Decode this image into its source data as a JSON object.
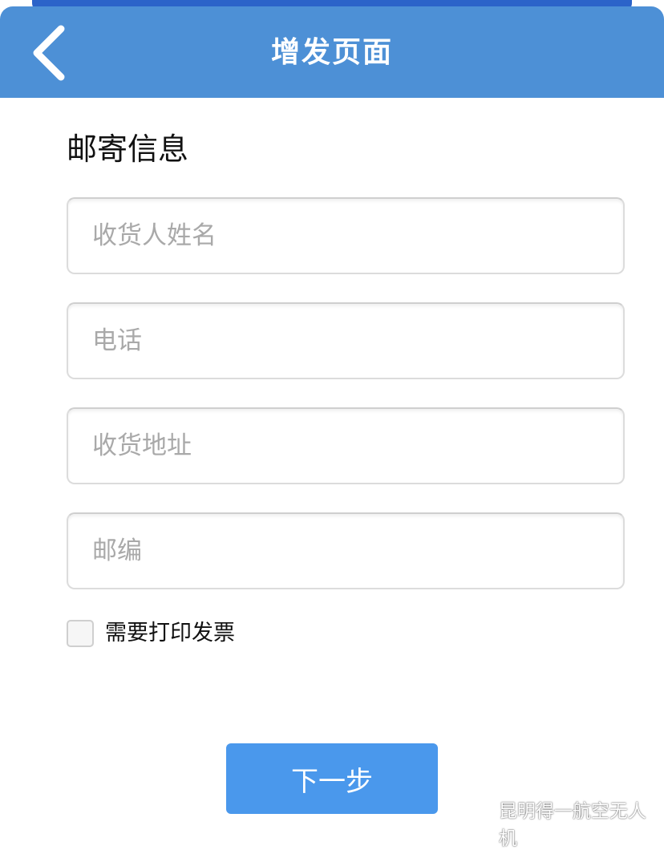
{
  "header": {
    "title": "增发页面",
    "back_icon": "chevron-left-icon"
  },
  "section": {
    "title": "邮寄信息"
  },
  "form": {
    "fields": [
      {
        "placeholder": "收货人姓名",
        "value": ""
      },
      {
        "placeholder": "电话",
        "value": ""
      },
      {
        "placeholder": "收货地址",
        "value": ""
      },
      {
        "placeholder": "邮编",
        "value": ""
      }
    ],
    "invoice_checkbox": {
      "label": "需要打印发票",
      "checked": false
    }
  },
  "actions": {
    "next_label": "下一步"
  },
  "watermark": {
    "text": "昆明得一航空无人机",
    "icon": "wechat-icon"
  },
  "colors": {
    "header_bg": "#4d90d6",
    "top_strip": "#2b63c9",
    "button_bg": "#4a98ec"
  }
}
